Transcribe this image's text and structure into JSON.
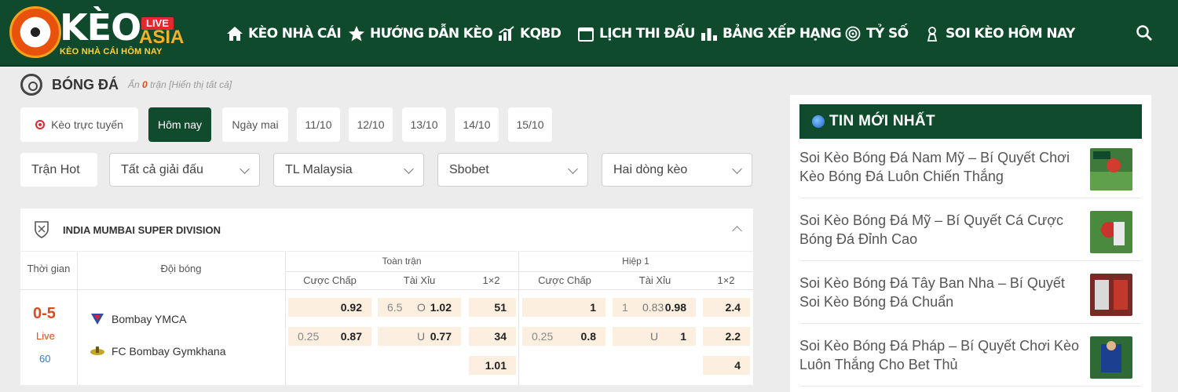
{
  "header": {
    "logo": {
      "brand": "KÈO",
      "live_badge": "LIVE",
      "asia": "ASIA",
      "tagline": "KÈO NHÀ CÁI HÔM NAY"
    },
    "nav": [
      {
        "label": "KÈO NHÀ CÁI",
        "icon": "home-icon"
      },
      {
        "label": "HƯỚNG DẪN KÈO",
        "icon": "star-icon"
      },
      {
        "label": "KQBD",
        "icon": "chart-icon"
      },
      {
        "label": "LỊCH THI ĐẤU",
        "icon": "calendar-icon"
      },
      {
        "label": "BẢNG XẾP HẠNG",
        "icon": "ranking-icon"
      },
      {
        "label": "TỶ SỐ",
        "icon": "target-icon"
      },
      {
        "label": "SOI KÈO HÔM NAY",
        "icon": "trophy-icon"
      }
    ],
    "search_icon": "search-icon",
    "colors": {
      "bg": "#0f4a2c",
      "accent": "#f3b12a",
      "live": "#e4282e"
    }
  },
  "sport": {
    "title": "BÓNG ĐÁ",
    "hidden_prefix": "Ẩn",
    "hidden_count": "0",
    "hidden_suffix": "trận [Hiển thị tất cả]"
  },
  "date_tabs": [
    {
      "label": "Kèo trực tuyến",
      "active": false
    },
    {
      "label": "Hôm nay",
      "active": true
    },
    {
      "label": "Ngày mai",
      "active": false
    },
    {
      "label": "11/10",
      "active": false
    },
    {
      "label": "12/10",
      "active": false
    },
    {
      "label": "13/10",
      "active": false
    },
    {
      "label": "14/10",
      "active": false
    },
    {
      "label": "15/10",
      "active": false
    }
  ],
  "filters": {
    "hot": "Trận Hot",
    "league": "Tất cả giải đấu",
    "odds_type": "TL Malaysia",
    "bookmaker": "Sbobet",
    "lines": "Hai dòng kèo"
  },
  "league": {
    "name": "INDIA MUMBAI SUPER DIVISION",
    "columns": {
      "time": "Thời gian",
      "team": "Đội bóng",
      "full_match": "Toàn trận",
      "first_half": "Hiệp 1",
      "handicap": "Cược Chấp",
      "over_under": "Tài Xỉu",
      "x12": "1×2"
    },
    "match": {
      "score": "0-5",
      "status": "Live",
      "minute": "60",
      "home": "Bombay YMCA",
      "away": "FC Bombay Gymkhana",
      "full": {
        "hdp_home": "0.92",
        "hdp_line": "0.25",
        "hdp_away": "0.87",
        "ou_line": "6.5",
        "ou_over_label": "O",
        "ou_over": "1.02",
        "ou_under_label": "U",
        "ou_under": "0.77",
        "x12_home": "51",
        "x12_away": "34",
        "x12_draw": "1.01"
      },
      "half": {
        "hdp_home": "1",
        "hdp_line": "0.25",
        "hdp_away": "0.8",
        "ou_line": "1",
        "ou_mid": "0.83",
        "ou_over": "0.98",
        "ou_under_label": "U",
        "ou_under": "1",
        "x12_home": "2.4",
        "x12_away": "2.2",
        "x12_draw": "4"
      }
    }
  },
  "sidebar": {
    "title": "TIN MỚI NHẤT",
    "news": [
      {
        "title": "Soi Kèo Bóng Đá Nam Mỹ – Bí Quyết Chơi Kèo Bóng Đá Luôn Chiến Thắng"
      },
      {
        "title": "Soi Kèo Bóng Đá Mỹ – Bí Quyết Cá Cược Bóng Đá Đỉnh Cao"
      },
      {
        "title": "Soi Kèo Bóng Đá Tây Ban Nha – Bí Quyết Soi Kèo Bóng Đá Chuẩn"
      },
      {
        "title": "Soi Kèo Bóng Đá Pháp – Bí Quyết Chơi Kèo Luôn Thắng Cho Bet Thủ"
      }
    ]
  }
}
